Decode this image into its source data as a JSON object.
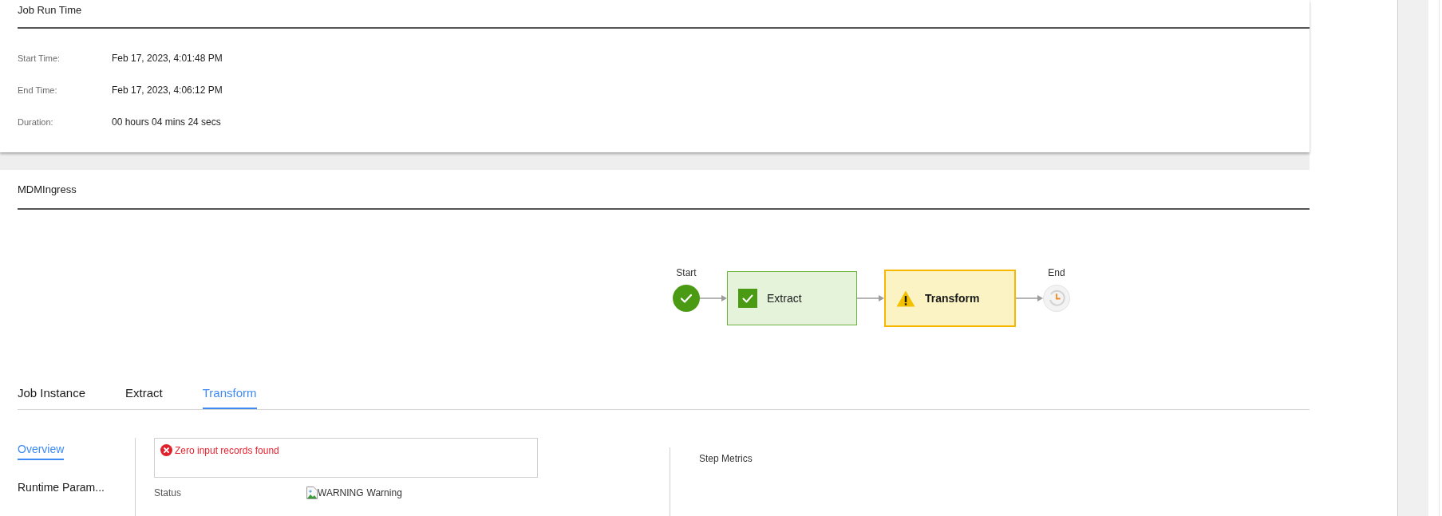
{
  "job_run_time": {
    "title": "Job Run Time",
    "fields": [
      {
        "label": "Start Time:",
        "value": "Feb 17, 2023, 4:01:48 PM"
      },
      {
        "label": "End Time:",
        "value": "Feb 17, 2023, 4:06:12 PM"
      },
      {
        "label": "Duration:",
        "value": "00 hours 04 mins 24 secs"
      }
    ]
  },
  "job": {
    "title": "MDMIngress",
    "flow": {
      "start": {
        "label": "Start",
        "kind": "success"
      },
      "steps": [
        {
          "name": "Extract",
          "kind": "success",
          "selected": false
        },
        {
          "name": "Transform",
          "kind": "warning",
          "selected": true
        }
      ],
      "end": {
        "label": "End",
        "kind": "pending"
      }
    }
  },
  "tabs": [
    {
      "label": "Job Instance",
      "selected": false
    },
    {
      "label": "Extract",
      "selected": false
    },
    {
      "label": "Transform",
      "selected": true
    }
  ],
  "side_nav": [
    {
      "label": "Overview",
      "selected": true
    },
    {
      "label": "Runtime Param...",
      "selected": false
    }
  ],
  "message": {
    "kind": "error",
    "text": "Zero input records found"
  },
  "details": [
    {
      "label": "Status",
      "image_alt": "WARNING",
      "value": "Warning"
    }
  ],
  "step_metrics": {
    "title": "Step Metrics"
  }
}
